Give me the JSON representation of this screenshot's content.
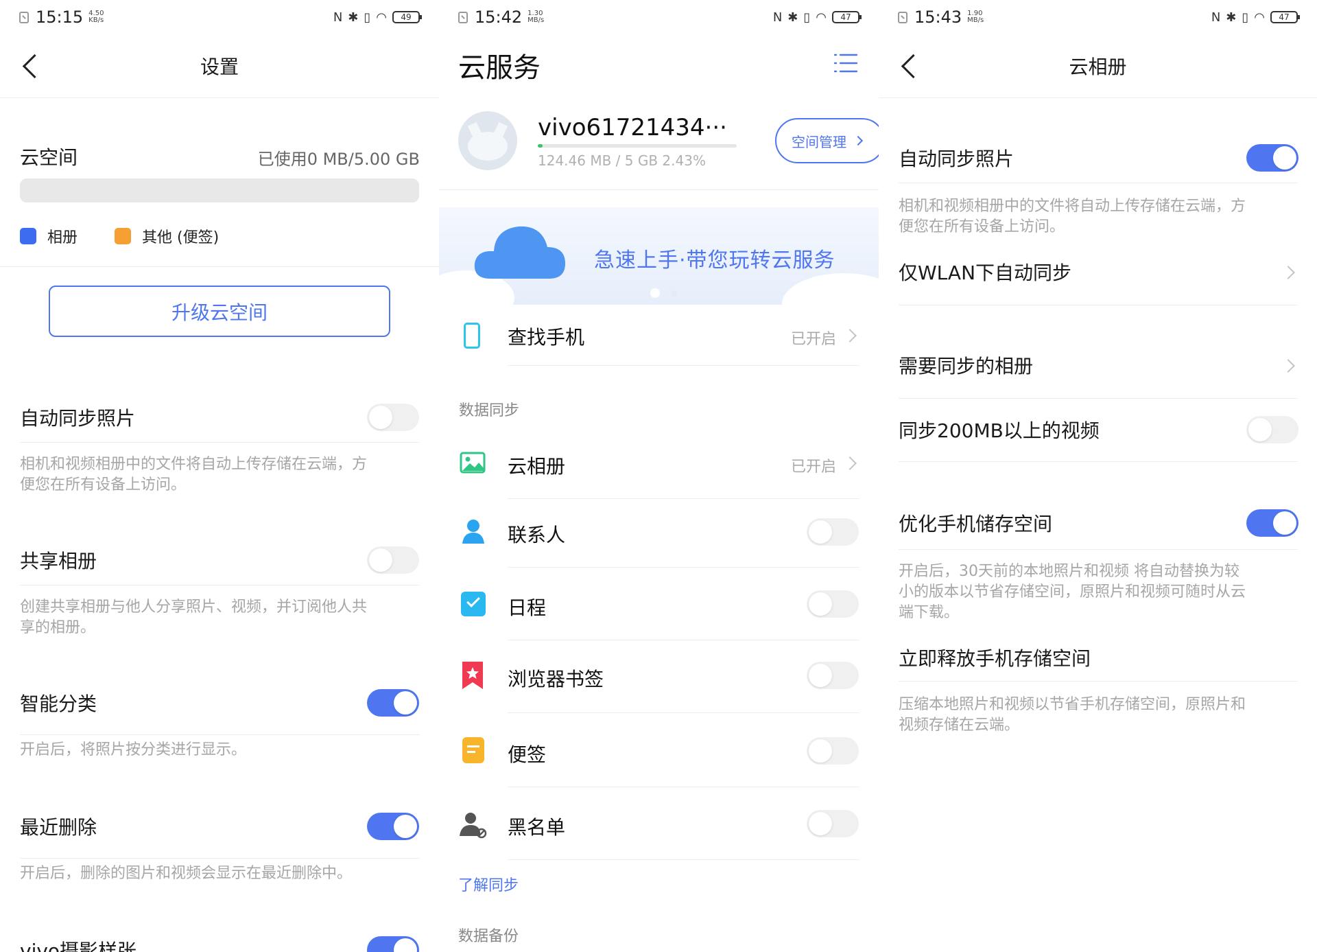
{
  "colors": {
    "accent": "#4f76f0",
    "photo": "#3d6cf0",
    "other": "#f6a033",
    "cloud": "#4f95f2"
  },
  "screen1": {
    "status": {
      "time": "15:15",
      "speed_value": "4.50",
      "speed_unit": "KB/s",
      "battery": "49"
    },
    "title": "设置",
    "cloud_space": {
      "label": "云空间",
      "usage": "已使用0 MB/5.00 GB"
    },
    "legend": [
      {
        "label": "相册"
      },
      {
        "label": "其他 (便签)"
      }
    ],
    "upgrade_button": "升级云空间",
    "settings": [
      {
        "title": "自动同步照片",
        "desc": "相机和视频相册中的文件将自动上传存储在云端，方\n便您在所有设备上访问。",
        "on": false
      },
      {
        "title": "共享相册",
        "desc": "创建共享相册与他人分享照片、视频，并订阅他人共\n享的相册。",
        "on": false
      },
      {
        "title": "智能分类",
        "desc": "开启后，将照片按分类进行显示。",
        "on": true
      },
      {
        "title": "最近删除",
        "desc": "开启后，删除的图片和视频会显示在最近删除中。",
        "on": true
      },
      {
        "title": "vivo摄影样张",
        "on": true
      }
    ]
  },
  "screen2": {
    "status": {
      "time": "15:42",
      "speed_value": "1.30",
      "speed_unit": "MB/s",
      "battery": "47"
    },
    "title": "云服务",
    "account": {
      "name": "vivo61721434···",
      "usage": "124.46 MB / 5 GB 2.43%",
      "usage_fraction": 0.0243,
      "manage_button": "空间管理"
    },
    "banner": {
      "text": "急速上手·带您玩转云服务"
    },
    "find_phone": {
      "label": "查找手机",
      "status": "已开启"
    },
    "sync_section": "数据同步",
    "sync_items": [
      {
        "label": "云相册",
        "status": "已开启",
        "icon": "image-icon"
      },
      {
        "label": "联系人",
        "on": false,
        "icon": "contact-icon"
      },
      {
        "label": "日程",
        "on": false,
        "icon": "calendar-check-icon"
      },
      {
        "label": "浏览器书签",
        "on": false,
        "icon": "bookmark-icon"
      },
      {
        "label": "便签",
        "on": false,
        "icon": "note-icon"
      },
      {
        "label": "黑名单",
        "on": false,
        "icon": "blacklist-icon"
      }
    ],
    "learn_link": "了解同步",
    "backup_section": "数据备份"
  },
  "screen3": {
    "status": {
      "time": "15:43",
      "speed_value": "1.90",
      "speed_unit": "MB/s",
      "battery": "47"
    },
    "title": "云相册",
    "auto_sync": {
      "title": "自动同步照片",
      "desc": "相机和视频相册中的文件将自动上传存储在云端，方\n便您在所有设备上访问。",
      "on": true
    },
    "wlan_only": {
      "title": "仅WLAN下自动同步"
    },
    "albums": {
      "title": "需要同步的相册"
    },
    "large_video": {
      "title": "同步200MB以上的视频",
      "on": false
    },
    "optimize": {
      "title": "优化手机储存空间",
      "desc": "开启后，30天前的本地照片和视频 将自动替换为较\n小的版本以节省存储空间，原照片和视频可随时从云\n端下载。",
      "on": true
    },
    "release": {
      "title": "立即释放手机存储空间",
      "desc": "压缩本地照片和视频以节省手机存储空间，原照片和\n视频存储在云端。"
    }
  }
}
